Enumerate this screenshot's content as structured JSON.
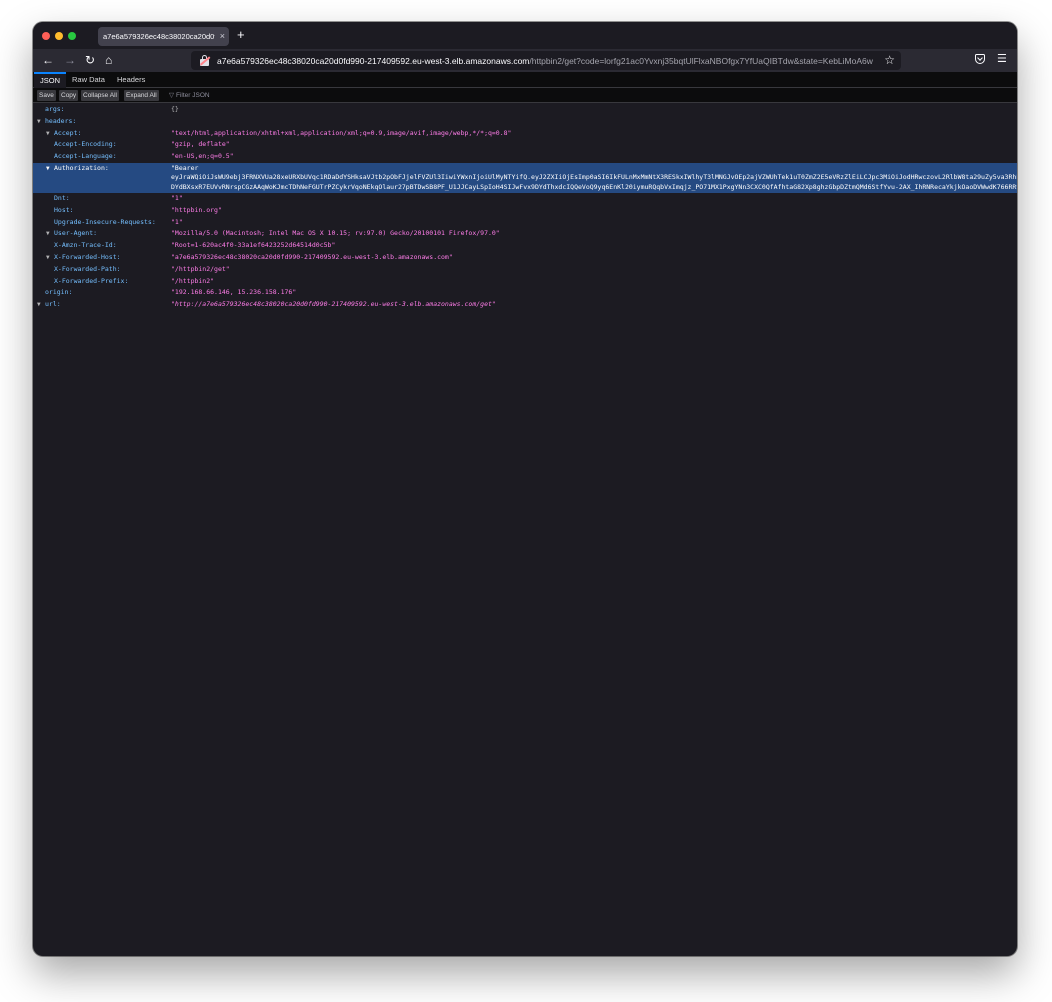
{
  "browser": {
    "tab_title": "a7e6a579326ec48c38020ca20d0fd990-217409592.eu-west-3.elb.amazonaws.com",
    "tab_close": "×",
    "new_tab": "+",
    "url_host": "a7e6a579326ec48c38020ca20d0fd990-217409592.eu-west-3.elb.amazonaws.com",
    "url_rest": "/httpbin2/get?code=lorfg21ac0Yvxnj35bqtUlFlxaNBOfgx7YfUaQIBTdw&state=KebLiMoA6w"
  },
  "viewer": {
    "tabs": [
      "JSON",
      "Raw Data",
      "Headers"
    ],
    "toolbar": [
      "Save",
      "Copy",
      "Collapse All",
      "Expand All"
    ],
    "filter_placeholder": "Filter JSON"
  },
  "json": {
    "args_key": "args:",
    "args_val": "{}",
    "headers_key": "headers:",
    "rows": [
      {
        "key": "Accept:",
        "value": "\"text/html,application/xhtml+xml,application/xml;q=0.9,image/avif,image/webp,*/*;q=0.8\"",
        "twisty": true
      },
      {
        "key": "Accept-Encoding:",
        "value": "\"gzip, deflate\"",
        "twisty": false
      },
      {
        "key": "Accept-Language:",
        "value": "\"en-US,en;q=0.5\"",
        "twisty": false
      }
    ],
    "authorization": {
      "key": "Authorization:",
      "line1": "\"Bearer",
      "line2": "eyJraWQiOiJsWU9ebj3FRNXVUa28xeURXbUVqc1RDaDdYSHksaVJtb2pObFJjelFVZUl3IiwiYWxnIjoiUlMyNTYifQ.eyJ2ZXIiOjEsImp0aSI6IkFULnMxMmNtX3RESkxIWlhyT3lMNGJvOEp2ajVZWUhTek1uT0ZmZ2E5eVRzZlEiLCJpc3MiOiJodHRwczovL2RlbW8ta29uZy5va3RhLmNvbS9vYXV0aDIvZGVmYXVsdCIsImF1ZCI6ImFwaTovL2RlZmF1bHQiLCJpYXQiOjE2NDU1NDUwMjMsImV4cCI6MTY0NTU0ODYyMywiY2lkIjoiMG9hM2VyeGRxbnZ5dmhMSjU1ZDciLCJ1aWQiOiIwMHUzZXJ5bnR6Y0tOTzRQQzVkNyIsInNjcCI6WyJvcGVuaWQiXSwiYXV0aF90aW1lIjoxNjQ1NTQ1MDIxLCJzdWIiOiJ0ZXN0QGV4YW1wbGUuY29tIn0",
      "line3": "DYdBXsxR7EUVvRNrspCGzAAqWoKJmcTDhNeFGUTrPZCykrVqoNEkqOlaur27pBTDwSB8PF_U1JJCayLSpIoH4SIJwFvx9DYdThxdcIQQeVoQ9yq6EnKl20iymuRQqbVxImqjz_PO71MX1PxgYNn3CXC0QfAfhtaG82Xp8ghzGbpDZtmQMd6StfYvu-2AX_IhRNRecaYkjkOaoDVWwdK766RRvr7WzLMBBkbW1Uc3w4ALGo54cqbgwtt8xALd6grg9LqPAvt7mHgF9yo8BmMj3FvPlaE9lLGsIpdsnTHSk5rbzEZ2gemJKYJuE8gVNmGVTDPjGMTJQlyXQvLuMw\""
    },
    "rows2": [
      {
        "key": "Dnt:",
        "value": "\"1\"",
        "twisty": false
      },
      {
        "key": "Host:",
        "value": "\"httpbin.org\"",
        "twisty": false
      },
      {
        "key": "Upgrade-Insecure-Requests:",
        "value": "\"1\"",
        "twisty": false
      },
      {
        "key": "User-Agent:",
        "value": "\"Mozilla/5.0 (Macintosh; Intel Mac OS X 10.15; rv:97.0) Gecko/20100101 Firefox/97.0\"",
        "twisty": true
      },
      {
        "key": "X-Amzn-Trace-Id:",
        "value": "\"Root=1-620ac4f0-33a1ef6423252d64514d0c5b\"",
        "twisty": false
      },
      {
        "key": "X-Forwarded-Host:",
        "value": "\"a7e6a579326ec48c38020ca20d0fd990-217409592.eu-west-3.elb.amazonaws.com\"",
        "twisty": true
      },
      {
        "key": "X-Forwarded-Path:",
        "value": "\"/httpbin2/get\"",
        "twisty": false
      },
      {
        "key": "X-Forwarded-Prefix:",
        "value": "\"/httpbin2\"",
        "twisty": false
      }
    ],
    "origin_key": "origin:",
    "origin_val": "\"192.168.66.146, 15.236.158.176\"",
    "url_key": "url:",
    "url_val": "\"http://a7e6a579326ec48c38020ca20d0fd990-217409592.eu-west-3.elb.amazonaws.com/get\""
  }
}
